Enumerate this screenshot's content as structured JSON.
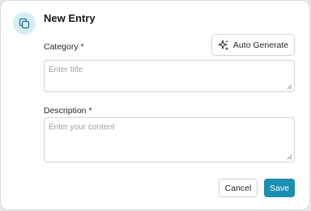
{
  "dialog": {
    "title": "New Entry",
    "icon": "copy-icon"
  },
  "category": {
    "label": "Category *",
    "placeholder": "Enter title",
    "value": ""
  },
  "auto_generate": {
    "label": "Auto Generate",
    "icon": "sparkles-icon"
  },
  "description": {
    "label": "Description *",
    "placeholder": "Enter your content",
    "value": ""
  },
  "actions": {
    "cancel_label": "Cancel",
    "save_label": "Save"
  },
  "colors": {
    "accent": "#1a8fb0",
    "icon_bg": "#d4eef4"
  }
}
